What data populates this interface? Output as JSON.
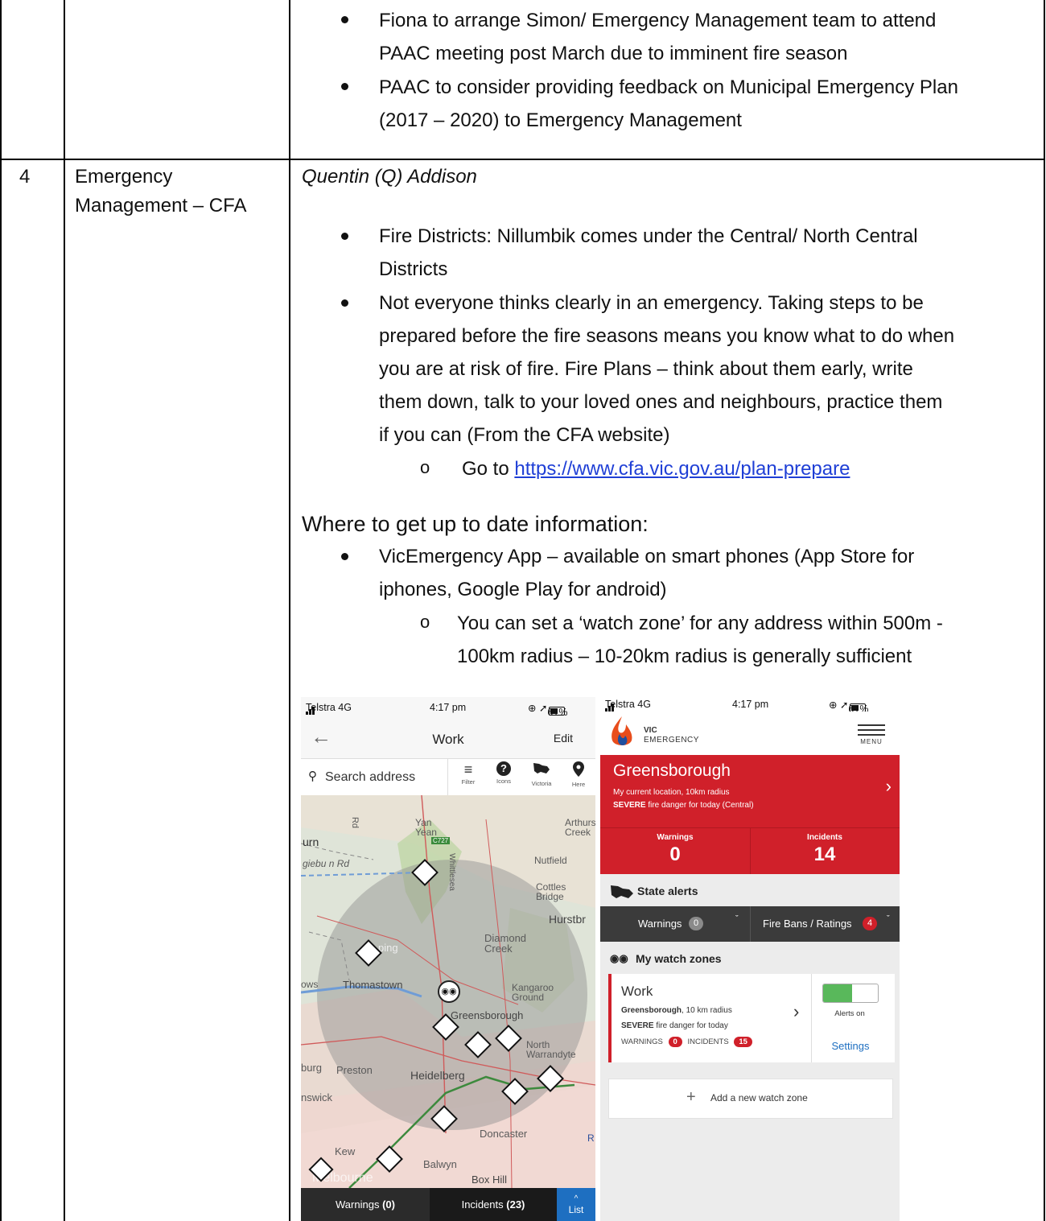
{
  "table": {
    "row_prev": {
      "bullets": [
        [
          "Fiona to arrange Simon/ Emergency Management team to attend",
          "PAAC meeting post March due to imminent fire season"
        ],
        [
          "PAAC to consider providing feedback on Municipal Emergency Plan",
          "(2017 – 2020) to Emergency Management"
        ]
      ]
    },
    "row4": {
      "number": "4",
      "topic_lines": [
        "Emergency",
        "Management – CFA"
      ],
      "presenter": "Quentin (Q) Addison",
      "bullets": [
        [
          "Fire Districts: Nillumbik comes under the Central/ North Central",
          "Districts"
        ],
        [
          "Not everyone thinks clearly in an emergency. Taking steps to be",
          "prepared before the fire seasons means you know what to do when",
          "you are at risk of fire. Fire Plans – think about them early, write",
          "them down, talk to your loved ones and neighbours, practice them",
          "if you can (From the CFA website)"
        ]
      ],
      "goto_prefix": "Go to ",
      "goto_link": "https://www.cfa.vic.gov.au/plan-prepare",
      "info_heading": "Where to get up to date information:",
      "app_bullet": [
        "VicEmergency App – available on smart phones (App Store for",
        "iphones, Google Play for android)"
      ],
      "app_sub": [
        "You can set a ‘watch zone’  for any address within 500m -",
        "100km radius – 10-20km radius is generally sufficient"
      ]
    }
  },
  "phone_map": {
    "carrier": "Telstra 4G",
    "time": "4:17 pm",
    "battery": "61%",
    "title": "Work",
    "edit_label": "Edit",
    "search_placeholder": "Search address",
    "tools": [
      "Filter",
      "Icons",
      "Victoria",
      "Here"
    ],
    "map_labels": [
      "Yan Yean",
      "Arthurs Creek",
      "Nutfield",
      "Cottles Bridge",
      "Hurstbr",
      "Diamond Creek",
      "Kangaroo Ground",
      "Thomastown",
      "Greensborough",
      "North Warrandyte",
      "Heidelberg",
      "Preston",
      "Doncaster",
      "Kew",
      "Balwyn",
      "Box Hill",
      "Melbourne",
      "C727",
      "Whittlesea",
      "urn",
      "giebu n Rd",
      "ping",
      "ows",
      "burg",
      "nswick",
      "Rd",
      "R"
    ],
    "footer": {
      "warnings_label": "Warnings",
      "warnings_count": "(0)",
      "incidents_label": "Incidents",
      "incidents_count": "(23)",
      "list_label": "List"
    }
  },
  "phone_app": {
    "carrier": "Telstra 4G",
    "time": "4:17 pm",
    "battery": "61%",
    "brand_top": "VIC",
    "brand_bottom": "EMERGENCY",
    "menu_label": "MENU",
    "location": "Greensborough",
    "location_sub": "My current location, 10km radius",
    "danger_strong": "SEVERE",
    "danger_rest": " fire danger for today (Central)",
    "warnings_label": "Warnings",
    "warnings_value": "0",
    "incidents_label": "Incidents",
    "incidents_value": "14",
    "state_alerts": "State alerts",
    "tab_warnings": "Warnings",
    "tab_warnings_count": "0",
    "tab_firebans": "Fire Bans / Ratings",
    "tab_firebans_count": "4",
    "watch_zones": "My watch zones",
    "zone_name": "Work",
    "zone_place": "Greensborough",
    "zone_radius": ", 10 km radius",
    "zone_danger_strong": "SEVERE",
    "zone_danger_rest": " fire danger for today",
    "zone_warnings_label": "WARNINGS",
    "zone_warnings_count": "0",
    "zone_incidents_label": "INCIDENTS",
    "zone_incidents_count": "15",
    "alerts_on": "Alerts on",
    "settings": "Settings",
    "add_zone": "Add a new watch zone",
    "colors": {
      "red": "#d0202a",
      "dark": "#3b3b3b",
      "green": "#59b85b",
      "blue": "#1e6fc1"
    }
  }
}
